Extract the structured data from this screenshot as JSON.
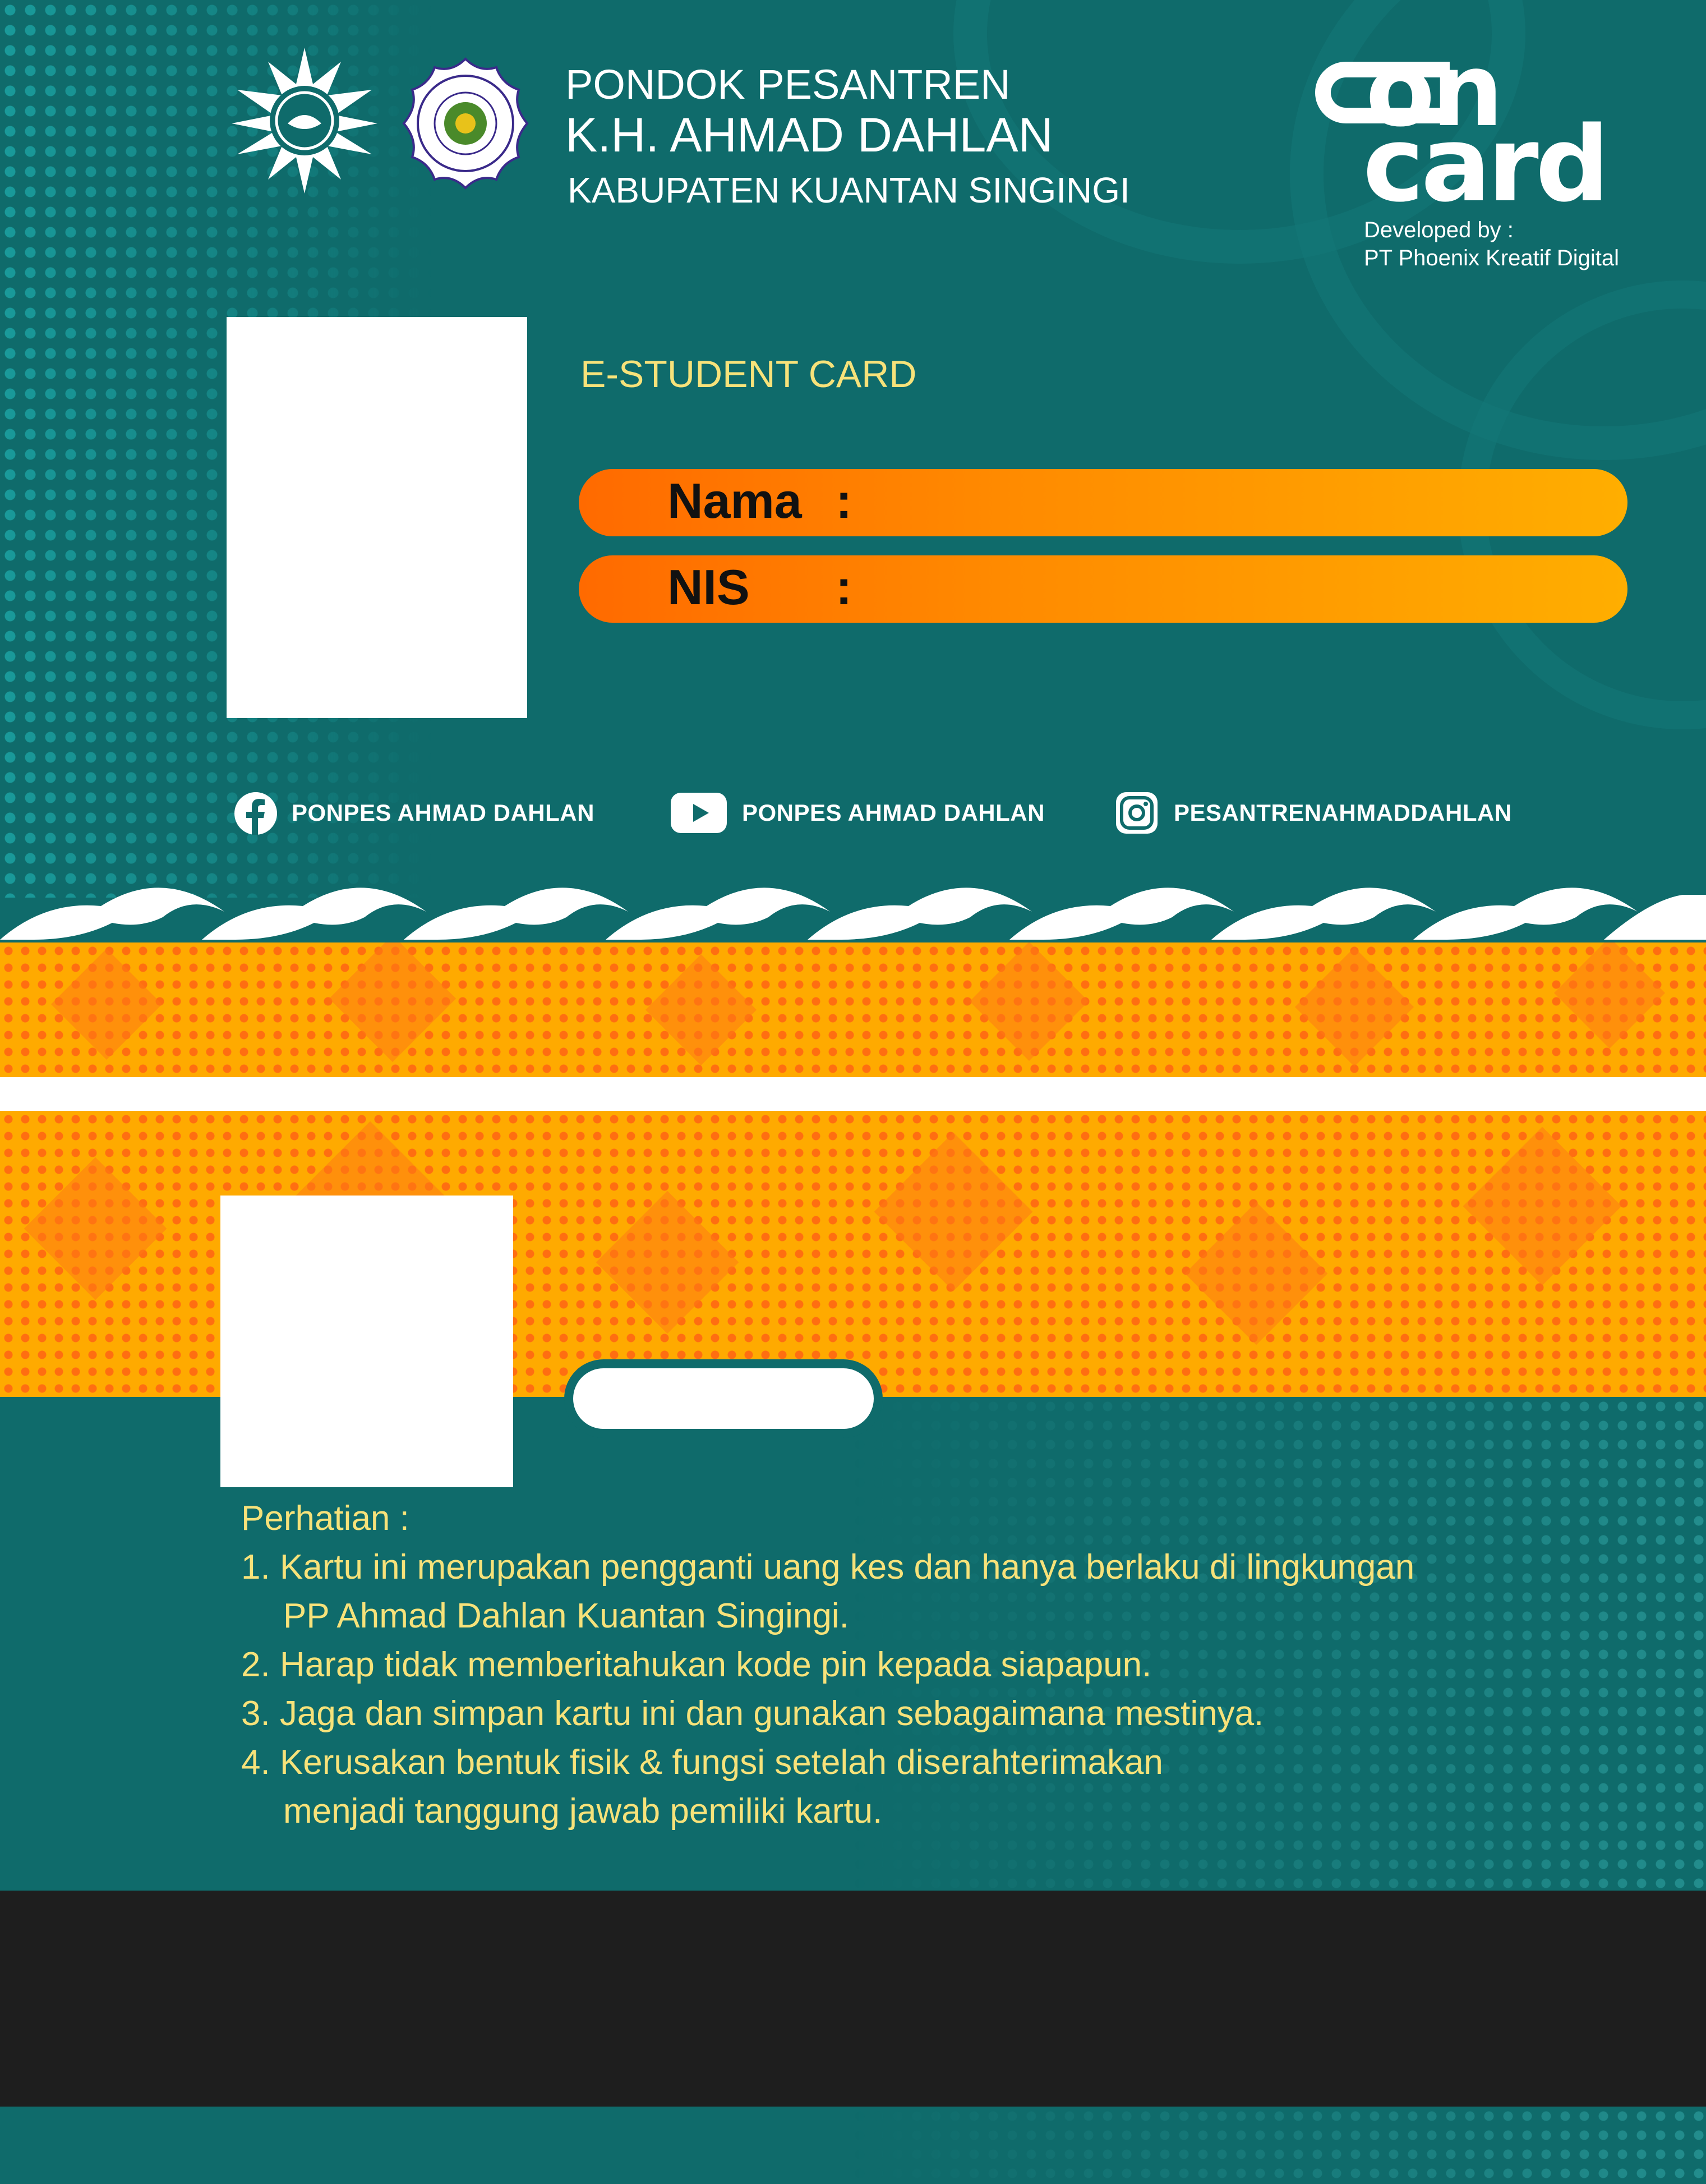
{
  "header": {
    "line1": "PONDOK PESANTREN",
    "line2": "K.H. AHMAD DAHLAN",
    "line3": "KABUPATEN KUANTAN SINGINGI"
  },
  "brand": {
    "logo_top": "on",
    "logo_bottom": "card",
    "developed_by": "Developed by :",
    "developer": "PT Phoenix Kreatif Digital"
  },
  "card": {
    "title": "E-STUDENT CARD",
    "name_label": "Nama",
    "nis_label": "NIS",
    "colon": ":"
  },
  "social": {
    "facebook": "PONPES AHMAD DAHLAN",
    "youtube": "PONPES AHMAD DAHLAN",
    "instagram": "PESANTRENAHMADDAHLAN"
  },
  "notice": {
    "heading": "Perhatian :",
    "items": [
      "1. Kartu ini merupakan pengganti uang kes dan hanya berlaku di lingkungan",
      "PP Ahmad Dahlan Kuantan Singingi.",
      "2. Harap tidak memberitahukan kode pin kepada siapapun.",
      "3. Jaga dan simpan kartu ini dan gunakan sebagaimana mestinya.",
      "4. Kerusakan bentuk fisik & fungsi setelah diserahterimakan",
      "menjadi tanggung jawab pemiliki kartu."
    ]
  },
  "colors": {
    "teal": "#0f6b6b",
    "orange": "#ffaa00",
    "accent_orange": "#ff6a00",
    "notice_text": "#f7e27a",
    "magnetic_strip": "#1e1e1e"
  }
}
